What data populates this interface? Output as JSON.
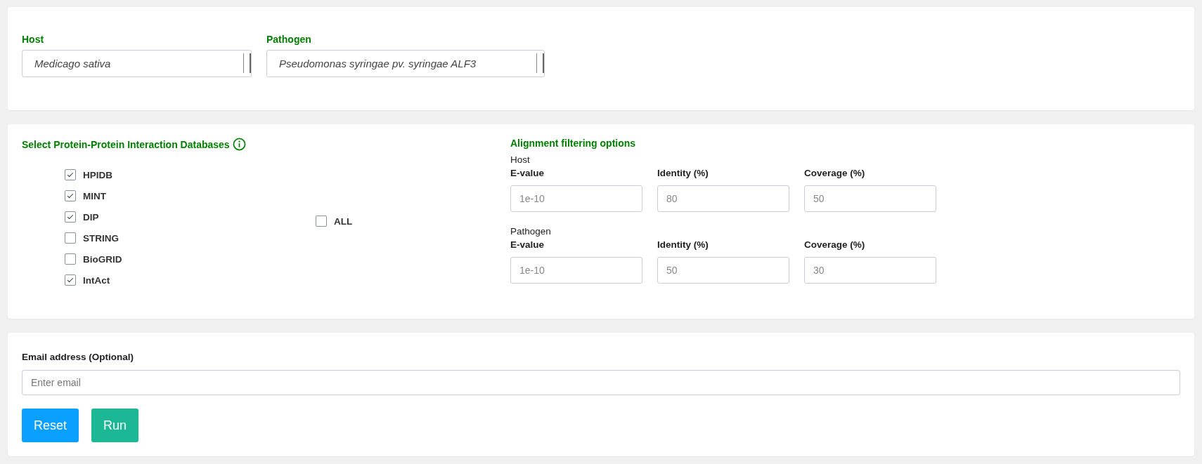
{
  "organisms": [
    {
      "label": "Host",
      "value": "Medicago sativa"
    },
    {
      "label": "Pathogen",
      "value": "Pseudomonas syringae pv. syringae ALF3"
    }
  ],
  "databases": {
    "title": "Select Protein-Protein Interaction Databases",
    "items": [
      {
        "label": "HPIDB",
        "checked": true
      },
      {
        "label": "MINT",
        "checked": true
      },
      {
        "label": "DIP",
        "checked": true
      },
      {
        "label": "STRING",
        "checked": false
      },
      {
        "label": "BioGRID",
        "checked": false
      },
      {
        "label": "IntAct",
        "checked": true
      }
    ],
    "all": {
      "label": "ALL",
      "checked": false
    }
  },
  "alignment": {
    "title": "Alignment filtering options",
    "groups": [
      {
        "name": "Host",
        "fields": [
          {
            "label": "E-value",
            "placeholder": "1e-10"
          },
          {
            "label": "Identity (%)",
            "placeholder": "80"
          },
          {
            "label": "Coverage (%)",
            "placeholder": "50"
          }
        ]
      },
      {
        "name": "Pathogen",
        "fields": [
          {
            "label": "E-value",
            "placeholder": "1e-10"
          },
          {
            "label": "Identity (%)",
            "placeholder": "50"
          },
          {
            "label": "Coverage (%)",
            "placeholder": "30"
          }
        ]
      }
    ]
  },
  "email": {
    "label": "Email address (Optional)",
    "placeholder": "Enter email"
  },
  "buttons": [
    {
      "label": "Reset",
      "kind": "secondary"
    },
    {
      "label": "Run",
      "kind": "primary"
    }
  ]
}
